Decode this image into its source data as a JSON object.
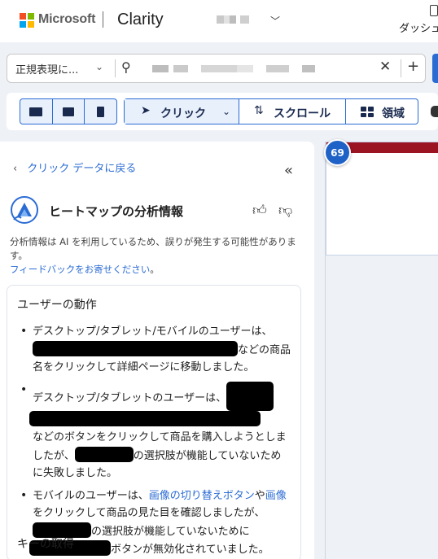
{
  "header": {
    "brand": "Microsoft",
    "product": "Clarity",
    "project_chevron_icon": "chevron-down-icon",
    "dashboard_label": "ダッシュ"
  },
  "filter": {
    "regex_label": "正規表現に...",
    "clear_icon": "close-icon",
    "add_icon": "plus-icon"
  },
  "toolbar": {
    "devices": [
      "desktop-icon",
      "tablet-icon",
      "mobile-icon"
    ],
    "click_label": "クリック",
    "scroll_label": "スクロール",
    "area_label": "領域"
  },
  "panel": {
    "back_label": "クリック データに戻る",
    "title": "ヒートマップの分析情報",
    "disclaimer": "分析情報は AI を利用しているため、誤りが発生する可能性があります。",
    "feedback_link": "フィードバックをお寄せください",
    "feedback_suffix": "。",
    "section1_heading": "ユーザーの動作",
    "bullet1": {
      "prefix": "デスクトップ/タブレット/モバイルのユーザーは、",
      "suffix": "などの商品名をクリックして詳細ページに移動しました。"
    },
    "bullet2": {
      "prefix": "デスクトップ/タブレットのユーザーは、",
      "mid": "などのボタンをクリックして商品を購入しようとしましたが、",
      "suffix": "の選択肢が機能していないために失敗しました。"
    },
    "bullet3": {
      "prefix": "モバイルのユーザーは、",
      "link1": "画像の切り替えボタン",
      "mid1": "や",
      "link2": "画像",
      "mid2": "をクリックして商品の見た目を確認しましたが、",
      "mid3": "の選択肢が機能していないために",
      "suffix": "ボタンが無効化されていました。"
    },
    "section2_heading": "キーの取得"
  },
  "canvas": {
    "badge_value": "69"
  },
  "colors": {
    "accent": "#2b6cd4",
    "badge": "#1f62c7",
    "banner_red": "#9b1422"
  }
}
